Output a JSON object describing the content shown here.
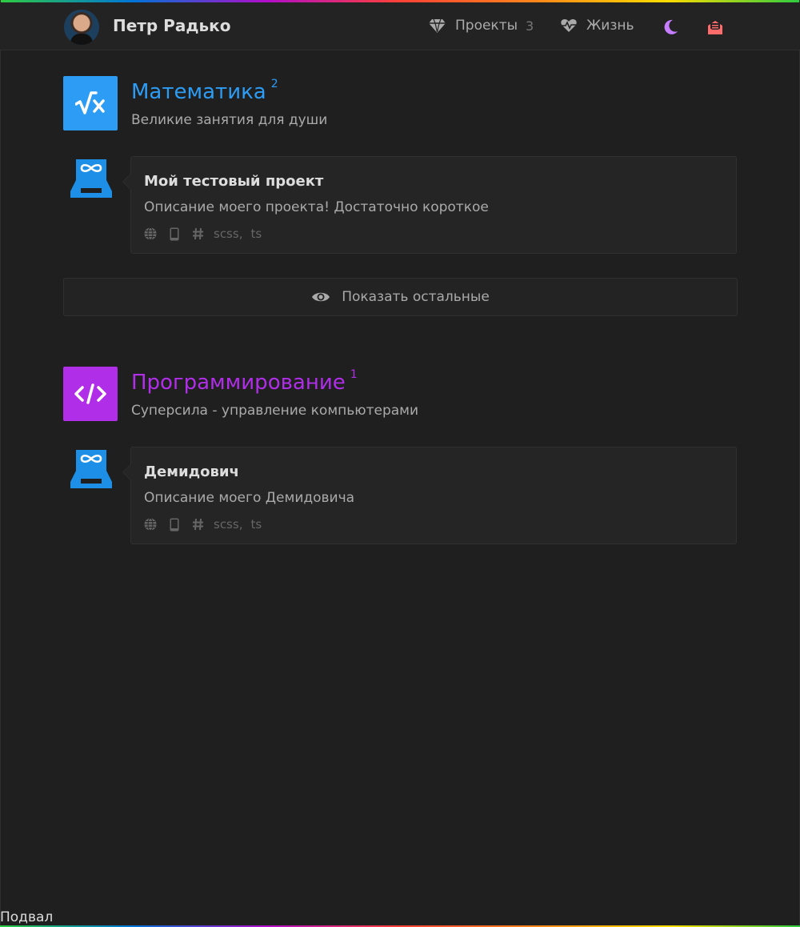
{
  "header": {
    "name": "Петр Радько",
    "nav": [
      {
        "label": "Проекты",
        "count": "3",
        "icon": "gem-icon"
      },
      {
        "label": "Жизнь",
        "icon": "heartbeat-icon"
      }
    ],
    "theme_icon": "moon-icon",
    "contact_icon": "envelope-open-icon"
  },
  "categories": [
    {
      "title": "Математика",
      "count": "2",
      "subtitle": "Великие занятия для души",
      "color": "#2d9cf5",
      "icon": "square-root-icon",
      "projects": [
        {
          "title": "Мой тестовый проект",
          "description": "Описание моего проекта! Достаточно короткое",
          "tags": [
            "scss,",
            "ts"
          ]
        }
      ],
      "show_more": "Показать остальные"
    },
    {
      "title": "Программирование",
      "count": "1",
      "subtitle": "Суперсила - управление компьютерами",
      "color": "#b02ee8",
      "icon": "code-icon",
      "projects": [
        {
          "title": "Демидович",
          "description": "Описание моего Демидовича",
          "tags": [
            "scss,",
            "ts"
          ]
        }
      ]
    }
  ],
  "footer": "Подвал",
  "colors": {
    "background": "#1f1f1f",
    "math": "#2d9cf5",
    "programming": "#b02ee8",
    "moon": "#c77dff",
    "contact": "#ff6b6b"
  }
}
